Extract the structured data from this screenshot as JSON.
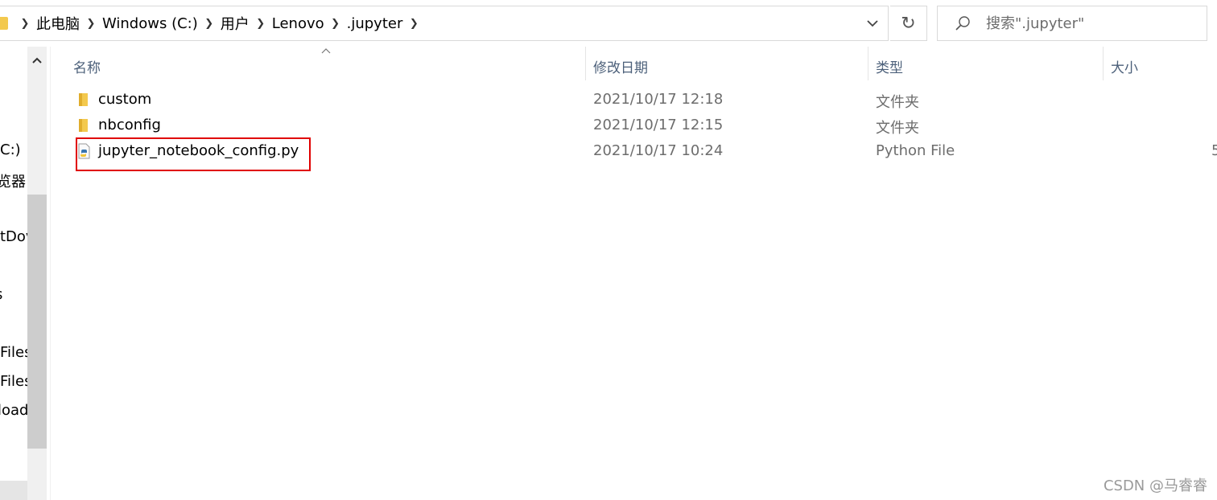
{
  "breadcrumb": {
    "items": [
      "此电脑",
      "Windows (C:)",
      "用户",
      "Lenovo",
      ".jupyter"
    ]
  },
  "search": {
    "placeholder": "搜索\".jupyter\""
  },
  "navpane": {
    "items": [
      "C:)",
      "览器",
      "tDov",
      "s",
      "Files",
      "Files",
      "load"
    ]
  },
  "columns": {
    "name": "名称",
    "date": "修改日期",
    "type": "类型",
    "size": "大小"
  },
  "files": [
    {
      "name": "custom",
      "date": "2021/10/17 12:18",
      "type": "文件夹",
      "size": "",
      "icon": "folder-icon"
    },
    {
      "name": "nbconfig",
      "date": "2021/10/17 12:15",
      "type": "文件夹",
      "size": "",
      "icon": "folder-icon"
    },
    {
      "name": "jupyter_notebook_config.py",
      "date": "2021/10/17 10:24",
      "type": "Python File",
      "size": "5",
      "icon": "python-file-icon"
    }
  ],
  "colors": {
    "folder": "#f3c94e",
    "highlight": "#e00000",
    "header_text": "#4c607a"
  },
  "watermark": "CSDN @马睿睿"
}
